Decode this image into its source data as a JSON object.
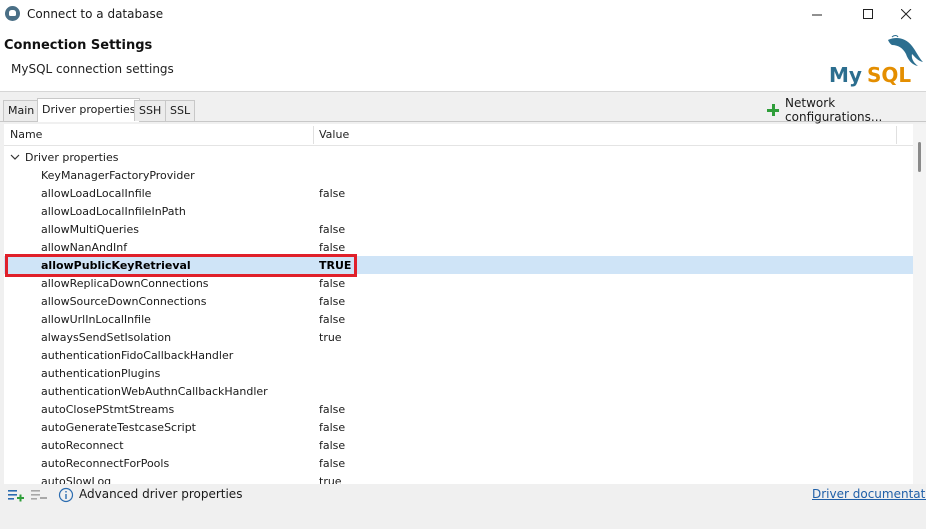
{
  "window": {
    "title": "Connect to a database"
  },
  "header": {
    "title": "Connection Settings",
    "subtitle": "MySQL connection settings",
    "logo_text": "MySQL"
  },
  "tabs": [
    {
      "label": "Main",
      "active": false
    },
    {
      "label": "Driver properties",
      "active": true
    },
    {
      "label": "SSH",
      "active": false
    },
    {
      "label": "SSL",
      "active": false
    }
  ],
  "network_config_label": "Network configurations...",
  "table": {
    "columns": {
      "name": "Name",
      "value": "Value"
    },
    "group_label": "Driver properties",
    "rows": [
      {
        "name": "KeyManagerFactoryProvider",
        "value": ""
      },
      {
        "name": "allowLoadLocalInfile",
        "value": "false"
      },
      {
        "name": "allowLoadLocalInfileInPath",
        "value": ""
      },
      {
        "name": "allowMultiQueries",
        "value": "false"
      },
      {
        "name": "allowNanAndInf",
        "value": "false"
      },
      {
        "name": "allowPublicKeyRetrieval",
        "value": "TRUE",
        "selected": true
      },
      {
        "name": "allowReplicaDownConnections",
        "value": "false"
      },
      {
        "name": "allowSourceDownConnections",
        "value": "false"
      },
      {
        "name": "allowUrlInLocalInfile",
        "value": "false"
      },
      {
        "name": "alwaysSendSetIsolation",
        "value": "true"
      },
      {
        "name": "authenticationFidoCallbackHandler",
        "value": ""
      },
      {
        "name": "authenticationPlugins",
        "value": ""
      },
      {
        "name": "authenticationWebAuthnCallbackHandler",
        "value": ""
      },
      {
        "name": "autoClosePStmtStreams",
        "value": "false"
      },
      {
        "name": "autoGenerateTestcaseScript",
        "value": "false"
      },
      {
        "name": "autoReconnect",
        "value": "false"
      },
      {
        "name": "autoReconnectForPools",
        "value": "false"
      },
      {
        "name": "autoSlowLog",
        "value": "true"
      }
    ]
  },
  "footer": {
    "advanced_label": "Advanced driver properties",
    "doc_link": "Driver documentation"
  },
  "colors": {
    "selection": "#cfe4f7",
    "highlight_border": "#e0202a",
    "link": "#1f5fa8",
    "logo_blue": "#2c6e8f",
    "logo_orange": "#e48e00",
    "accent_green": "#2f9e3a"
  }
}
